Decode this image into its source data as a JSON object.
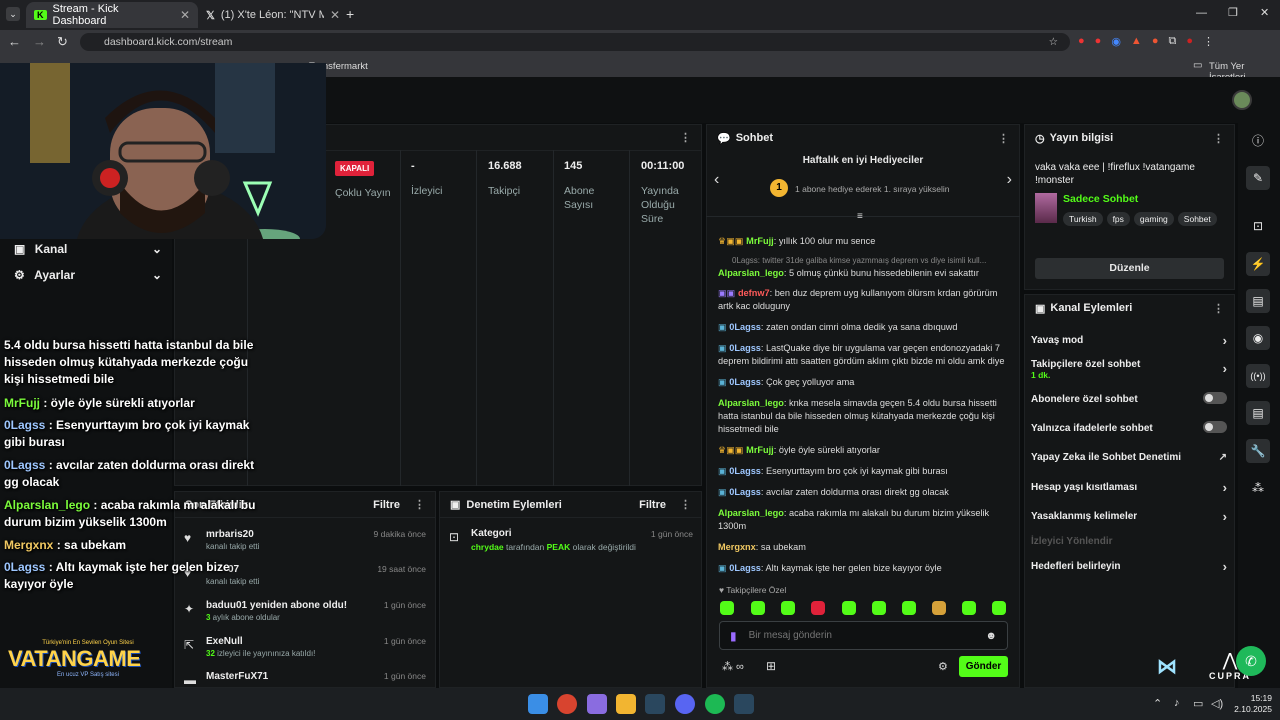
{
  "browser": {
    "tabs": [
      {
        "title": "Stream - Kick Dashboard"
      },
      {
        "title": "(1) X'te Léon: \"NTV Muhabiri Ha"
      }
    ],
    "url": "dashboard.kick.com/stream",
    "bookmark_visible": "Transfermarkt",
    "bookmarks_all": "Tüm Yer İşaretleri"
  },
  "left_nav": {
    "items": [
      {
        "label": "Kanal"
      },
      {
        "label": "Ayarlar"
      }
    ]
  },
  "stream_overview": {
    "status_badge": "KAPALI",
    "status_label": "Çoklu Yayın",
    "stats": [
      {
        "value": "-",
        "label": "İzleyici"
      },
      {
        "value": "16.688",
        "label": "Takipçi"
      },
      {
        "value": "145",
        "label": "Abone Sayısı"
      },
      {
        "value": "00:11:00",
        "label": "Yayında Olduğu Süre"
      }
    ]
  },
  "overlay_chat": [
    {
      "user": "",
      "text": "5.4 oldu bursa hissetti hatta istanbul da bile hisseden olmuş kütahyada merkezde çoğu kişi hissetmedi bile",
      "color": "#ffffff"
    },
    {
      "user": "MrFujj",
      "text": " : öyle öyle sürekli atıyorlar",
      "color": "#7cfc3c"
    },
    {
      "user": "0Lagss",
      "text": " : Esenyurttayım bro çok iyi kaymak gibi burası",
      "color": "#9ec7ff"
    },
    {
      "user": "0Lagss",
      "text": " : avcılar zaten doldurma orası direkt gg olacak",
      "color": "#9ec7ff"
    },
    {
      "user": "Alparslan_lego",
      "text": " : acaba rakımla mı alakalı bu durum bizim yükselik 1300m",
      "color": "#7cfc3c"
    },
    {
      "user": "Mergxnx",
      "text": " : sa ubekam",
      "color": "#f0c862"
    },
    {
      "user": "0Lagss",
      "text": " : Altı kaymak işte her gelen bize kayıyor öyle",
      "color": "#9ec7ff"
    }
  ],
  "activity": {
    "title": "Son Etkinlik",
    "filter": "Filtre",
    "items": [
      {
        "title": "mrbaris20",
        "sub": "kanalı takip etti",
        "time": "9 dakika önce",
        "icon": "heart-icon"
      },
      {
        "title": "07",
        "sub": "kanalı takip etti",
        "time": "19 saat önce",
        "icon": "heart-icon"
      },
      {
        "title": "baduu01 yeniden abone oldu!",
        "sub_prefix": "3",
        "sub": " aylık abone oldular",
        "time": "1 gün önce",
        "icon": "star-icon"
      },
      {
        "title": "ExeNull",
        "sub_prefix": "32",
        "sub": " izleyici ile yayınınıza katıldı!",
        "time": "1 gün önce",
        "icon": "raid-icon"
      },
      {
        "title": "MasterFuX71",
        "sub": "",
        "time": "1 gün önce",
        "icon": "gift-icon"
      }
    ]
  },
  "moderation": {
    "title": "Denetim Eylemleri",
    "filter": "Filtre",
    "items": [
      {
        "title": "Kategori",
        "actor": "chrydae",
        "mid": " tarafından ",
        "value": "PEAK",
        "end": " olarak değiştirildi",
        "time": "1 gün önce"
      }
    ]
  },
  "chat": {
    "title": "Sohbet",
    "leaderboard_title": "Haftalık en iyi Hediyeciler",
    "leaderboard_rank": "1",
    "leaderboard_text": "1 abone hediye ederek 1. sıraya yükselin",
    "messages": [
      {
        "user": "MrFujj",
        "text": ": yıllık 100 olur mu sence",
        "color": "#7cfc3c"
      },
      {
        "user": "",
        "text": "0Lagss: twitter 31de galiba kimse yazmmaış deprem vs diye isimli kull...",
        "color": "#888888",
        "reply": true
      },
      {
        "user": "Alparslan_lego",
        "text": ": 5 olmuş çünkü bunu hissedebilenin evi sakattır",
        "color": "#7cfc3c"
      },
      {
        "user": "defnw7",
        "text": ": ben duz deprem uyg kullanıyom ölürsm krdan görürüm artk kac olduguny",
        "color": "#ff5a5a"
      },
      {
        "user": "0Lagss",
        "text": ": zaten ondan cimri olma dedik ya sana dbıquwd",
        "color": "#9ec7ff"
      },
      {
        "user": "0Lagss",
        "text": ": LastQuake diye bir uygulama var geçen endonozyadaki 7 deprem bildirimi attı saatten gördüm aklım çıktı bizde mi oldu amk diye",
        "color": "#9ec7ff"
      },
      {
        "user": "0Lagss",
        "text": ": Çok geç yolluyor ama",
        "color": "#9ec7ff"
      },
      {
        "user": "Alparslan_lego",
        "text": ": knka mesela simavda geçen 5.4 oldu bursa hissetti hatta istanbul da bile hisseden olmuş kütahyada merkezde çoğu kişi hissetmedi bile",
        "color": "#7cfc3c"
      },
      {
        "user": "MrFujj",
        "text": ": öyle öyle sürekli atıyorlar",
        "color": "#7cfc3c"
      },
      {
        "user": "0Lagss",
        "text": ": Esenyurttayım bro çok iyi kaymak gibi burası",
        "color": "#9ec7ff"
      },
      {
        "user": "0Lagss",
        "text": ": avcılar zaten doldurma orası direkt gg olacak",
        "color": "#9ec7ff"
      },
      {
        "user": "Alparslan_lego",
        "text": ": acaba rakımla mı alakalı bu durum bizim yükselik 1300m",
        "color": "#7cfc3c"
      },
      {
        "user": "Mergxnx",
        "text": ": sa ubekam",
        "color": "#f0c862"
      },
      {
        "user": "0Lagss",
        "text": ": Altı kaymak işte her gelen bize kayıyor öyle",
        "color": "#9ec7ff"
      }
    ],
    "emote_section": "Takipçilere Özel",
    "input_placeholder": "Bir mesaj gönderin",
    "send_label": "Gönder"
  },
  "stream_info": {
    "title": "Yayın bilgisi",
    "stream_title": "vaka vaka eee | !fireflux !vatangame !monster",
    "category": "Sadece Sohbet",
    "tags": [
      "Turkish",
      "fps",
      "gaming",
      "Sohbet"
    ],
    "edit_label": "Düzenle"
  },
  "channel_actions": {
    "title": "Kanal Eylemleri",
    "items": [
      {
        "label": "Yavaş mod",
        "type": "chevron"
      },
      {
        "label": "Takipçilere özel sohbet",
        "sub": "1 dk.",
        "type": "chevron"
      },
      {
        "label": "Abonelere özel sohbet",
        "type": "toggle"
      },
      {
        "label": "Yalnızca ifadelerle sohbet",
        "type": "toggle"
      },
      {
        "label": "Yapay Zeka ile Sohbet Denetimi",
        "type": "external"
      },
      {
        "label": "Hesap yaşı kısıtlaması",
        "type": "chevron"
      },
      {
        "label": "Yasaklanmış kelimeler",
        "type": "chevron"
      },
      {
        "label": "İzleyici Yönlendir",
        "type": "disabled"
      },
      {
        "label": "Hedefleri belirleyin",
        "type": "chevron"
      }
    ]
  },
  "overlay_branding": {
    "vatangame": "VATANGAME",
    "vatangame_tag": "Türkiye'nin En Sevilen Oyun Sitesi",
    "vatangame_sub": "En ucuz VP Satış sitesi",
    "cupra": "CUPRA"
  },
  "taskbar": {
    "time": "15:19",
    "date": "2.10.2025"
  },
  "colors": {
    "kick_green": "#53fc18",
    "badge_red": "#e0223a",
    "bg": "#0b0d0e",
    "panel": "#141617"
  }
}
